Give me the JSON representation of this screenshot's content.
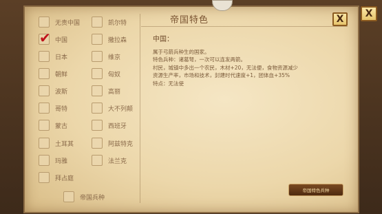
{
  "title": "帝国特色",
  "close_label": "X",
  "civs_left": [
    {
      "label": "无责中国",
      "checked": false
    },
    {
      "label": "中国",
      "checked": true
    },
    {
      "label": "日本",
      "checked": false
    },
    {
      "label": "朝鲜",
      "checked": false
    },
    {
      "label": "波斯",
      "checked": false
    },
    {
      "label": "哥特",
      "checked": false
    },
    {
      "label": "蒙古",
      "checked": false
    },
    {
      "label": "土耳其",
      "checked": false
    },
    {
      "label": "玛雅",
      "checked": false
    },
    {
      "label": "拜占庭",
      "checked": false
    }
  ],
  "civs_right": [
    {
      "label": "凯尔特",
      "checked": false
    },
    {
      "label": "撒拉森",
      "checked": false
    },
    {
      "label": "维京",
      "checked": false
    },
    {
      "label": "匈奴",
      "checked": false
    },
    {
      "label": "高丽",
      "checked": false
    },
    {
      "label": "大不列颠",
      "checked": false
    },
    {
      "label": "西班牙",
      "checked": false
    },
    {
      "label": "阿兹特克",
      "checked": false
    },
    {
      "label": "法兰克",
      "checked": false
    }
  ],
  "bottom_option": {
    "label": "帝国兵种",
    "checked": false
  },
  "info": {
    "heading": "中国：",
    "lines": [
      "属于弓箭兵种生的国家。",
      "特色兵种：诸葛弩，一次可以连发两箭。",
      "村民，城镇中多出一个农民，木材+20，无法便，食物资源减少",
      "资源生产率，市场和技术，封建时代速度+1，团体血+35%",
      "特点：无法使"
    ]
  },
  "action_button": "帝国特色兵种"
}
